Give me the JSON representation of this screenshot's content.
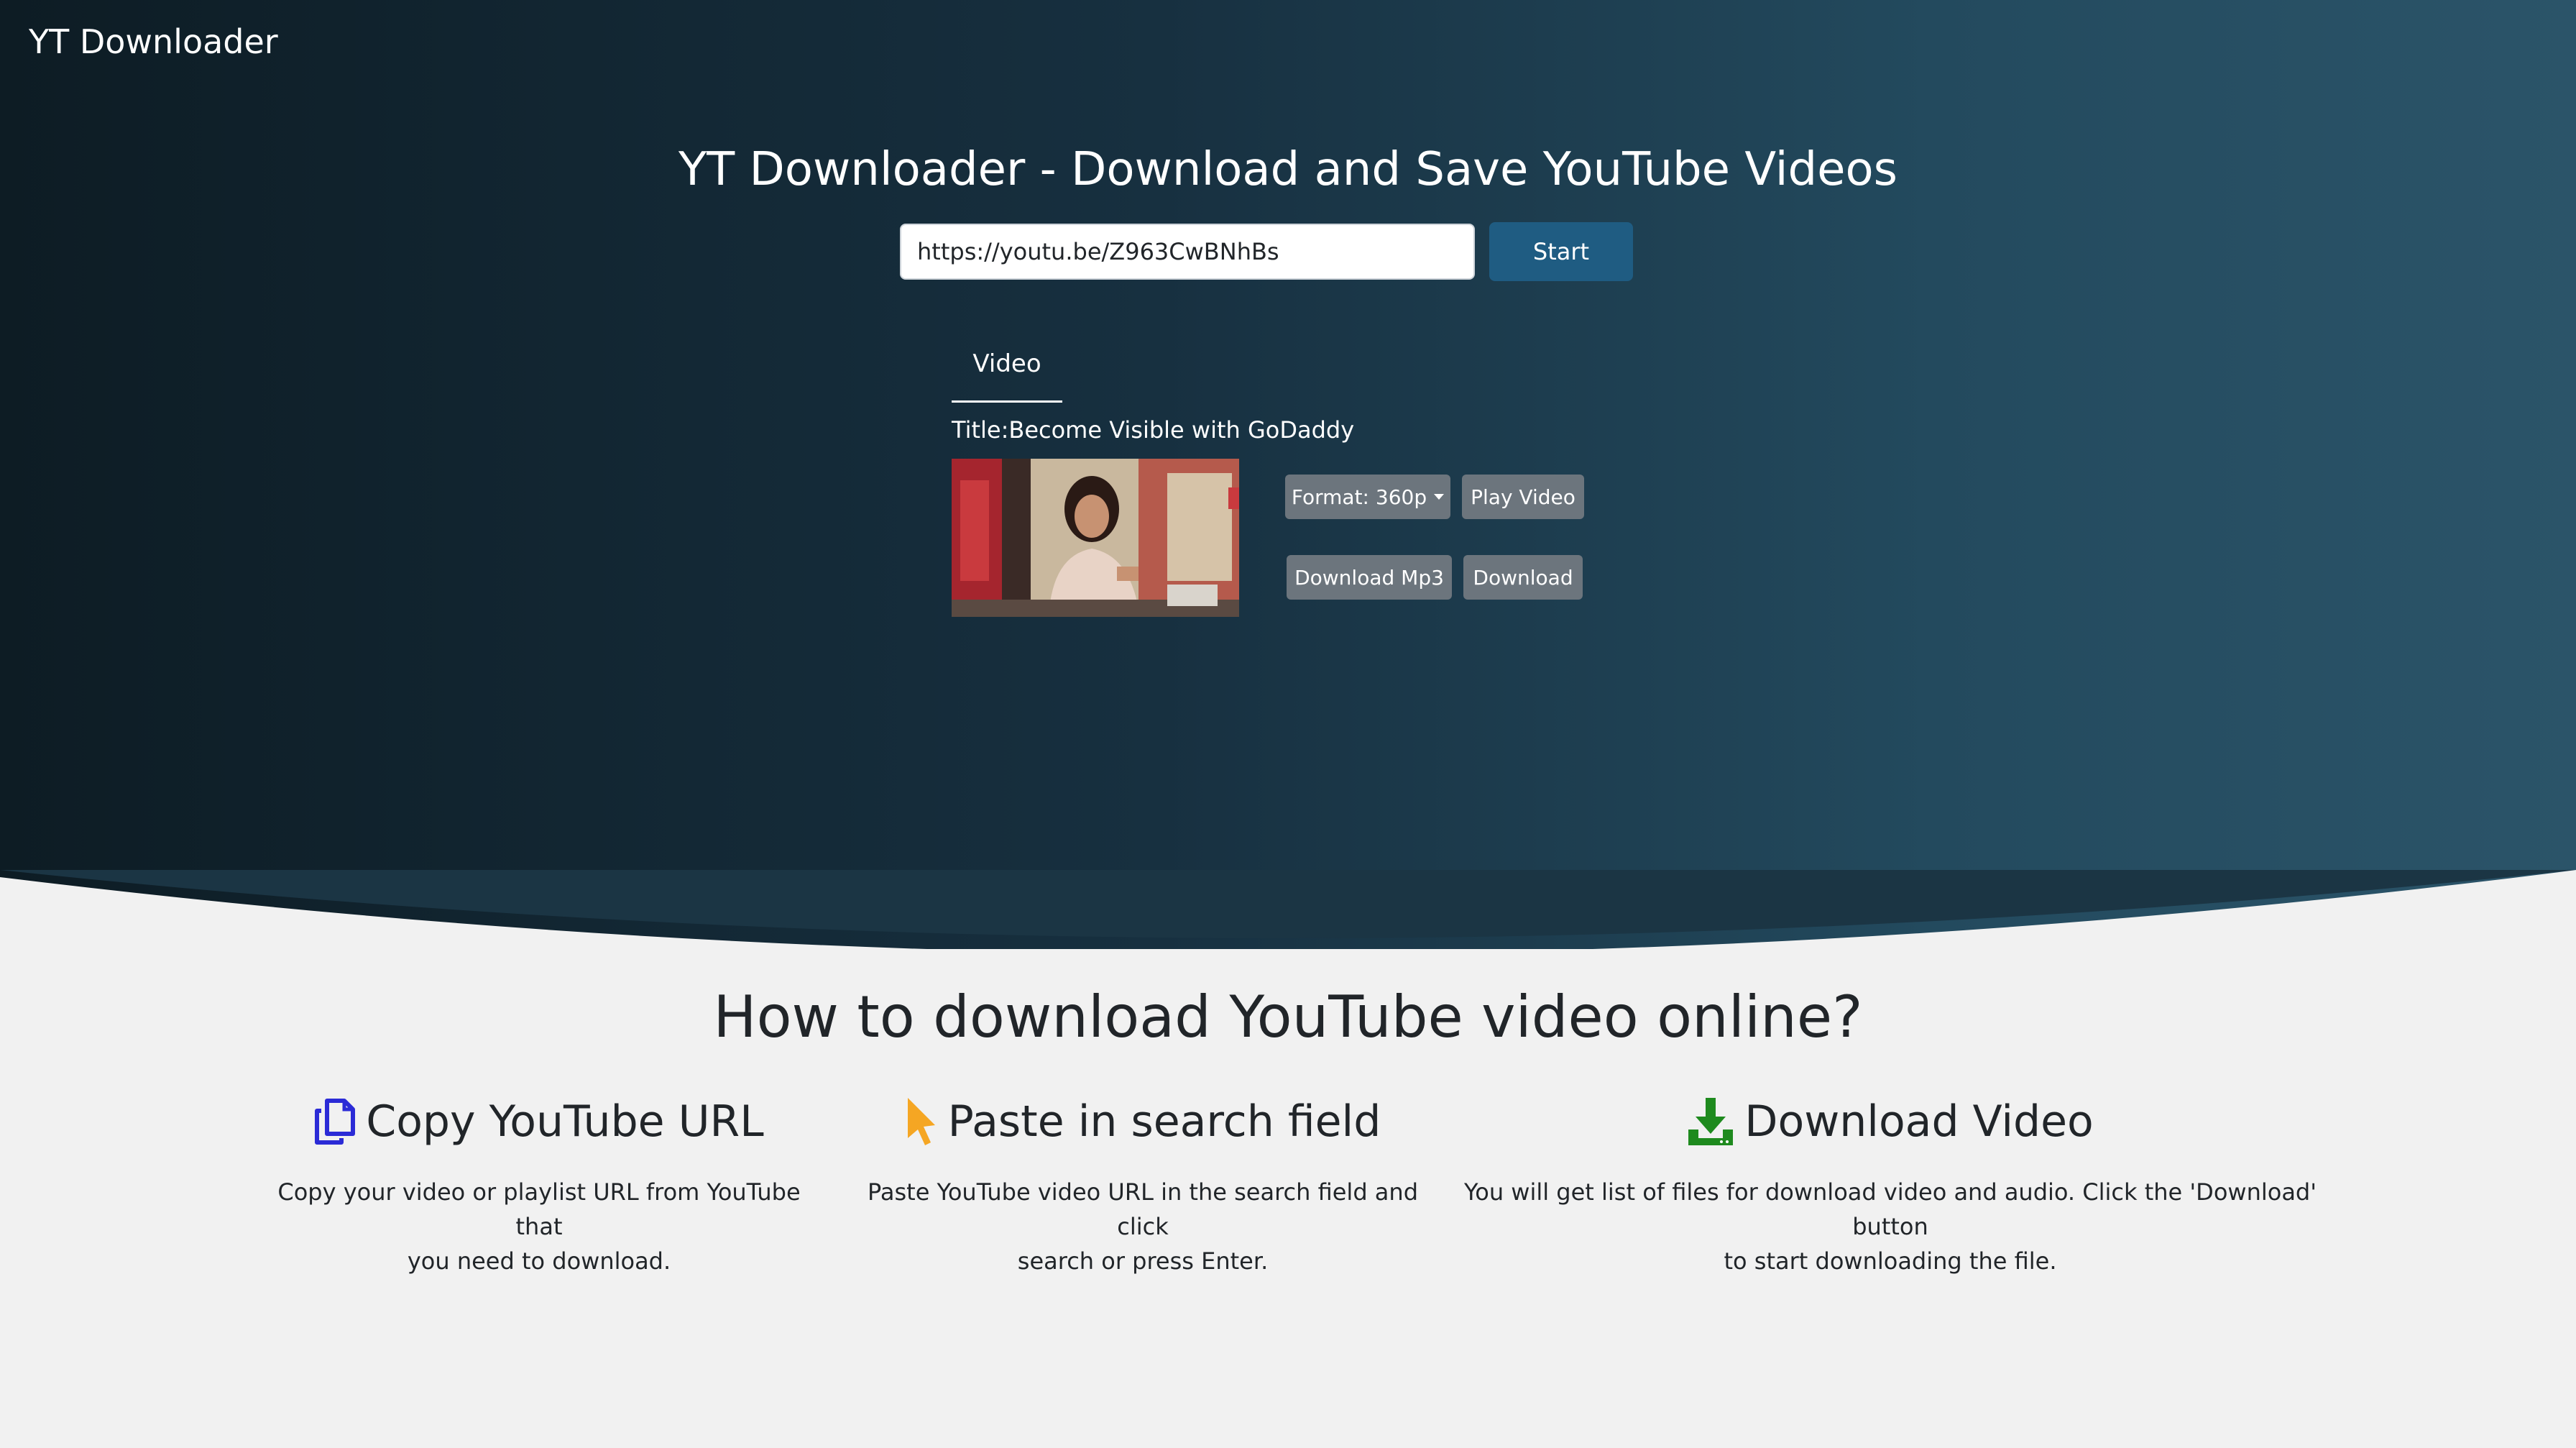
{
  "brand": "YT Downloader",
  "hero": {
    "title": "YT Downloader - Download and Save YouTube Videos",
    "url_value": "https://youtu.be/Z963CwBNhBs",
    "start_label": "Start"
  },
  "result": {
    "tab_label": "Video",
    "title_text": "Title:Become Visible with GoDaddy",
    "format_label": "Format: 360p",
    "play_label": "Play Video",
    "mp3_label": "Download Mp3",
    "download_label": "Download"
  },
  "howto": {
    "title": "How to download YouTube video online?",
    "steps": [
      {
        "icon": "copy-icon",
        "heading": "Copy YouTube URL",
        "desc_line1": "Copy your video or playlist URL from YouTube that",
        "desc_line2": "you need to download.",
        "color": "#2b2bd6"
      },
      {
        "icon": "pointer-icon",
        "heading": "Paste in search field",
        "desc_line1": "Paste YouTube video URL in the search field and click",
        "desc_line2": "search or press Enter.",
        "color": "#f5a623"
      },
      {
        "icon": "download-icon",
        "heading": "Download Video",
        "desc_line1": "You will get list of files for download video and audio. Click the 'Download' button",
        "desc_line2": "to start downloading the file.",
        "color": "#1e8a1e"
      }
    ]
  },
  "colors": {
    "hero_dark": "#0d1c24",
    "hero_light": "#2b5469",
    "start_button": "#1f5c82",
    "secondary_button": "#6c757d",
    "page_bg": "#f1f1f1"
  }
}
